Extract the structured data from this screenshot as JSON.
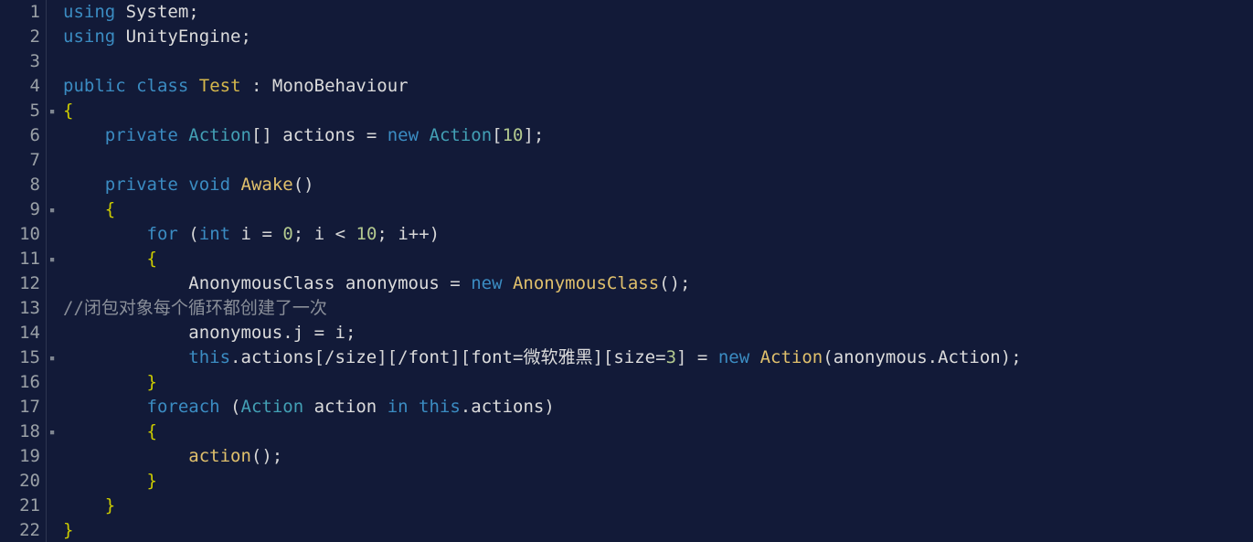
{
  "lines": {
    "1": [
      [
        "kw",
        "using"
      ],
      [
        "op",
        " "
      ],
      [
        "id",
        "System"
      ],
      [
        "pun",
        ";"
      ]
    ],
    "2": [
      [
        "kw",
        "using"
      ],
      [
        "op",
        " "
      ],
      [
        "id",
        "UnityEngine"
      ],
      [
        "pun",
        ";"
      ]
    ],
    "3": [
      [
        "op",
        ""
      ]
    ],
    "4": [
      [
        "kw",
        "public"
      ],
      [
        "op",
        " "
      ],
      [
        "kw",
        "class"
      ],
      [
        "op",
        " "
      ],
      [
        "yl",
        "Test"
      ],
      [
        "op",
        " "
      ],
      [
        "pun",
        ":"
      ],
      [
        "op",
        " "
      ],
      [
        "id",
        "MonoBehaviour"
      ]
    ],
    "5": [
      [
        "br",
        "{"
      ]
    ],
    "6": [
      [
        "op",
        "    "
      ],
      [
        "kw",
        "private"
      ],
      [
        "op",
        " "
      ],
      [
        "typ",
        "Action"
      ],
      [
        "pun",
        "[]"
      ],
      [
        "op",
        " "
      ],
      [
        "id",
        "actions"
      ],
      [
        "op",
        " "
      ],
      [
        "pun",
        "="
      ],
      [
        "op",
        " "
      ],
      [
        "kw",
        "new"
      ],
      [
        "op",
        " "
      ],
      [
        "typ",
        "Action"
      ],
      [
        "pun",
        "["
      ],
      [
        "num",
        "10"
      ],
      [
        "pun",
        "];"
      ]
    ],
    "7": [
      [
        "op",
        ""
      ]
    ],
    "8": [
      [
        "op",
        "    "
      ],
      [
        "kw",
        "private"
      ],
      [
        "op",
        " "
      ],
      [
        "kw",
        "void"
      ],
      [
        "op",
        " "
      ],
      [
        "fun",
        "Awake"
      ],
      [
        "pun",
        "()"
      ]
    ],
    "9": [
      [
        "op",
        "    "
      ],
      [
        "br",
        "{"
      ]
    ],
    "10": [
      [
        "op",
        "        "
      ],
      [
        "kw",
        "for"
      ],
      [
        "op",
        " "
      ],
      [
        "pun",
        "("
      ],
      [
        "kw",
        "int"
      ],
      [
        "op",
        " "
      ],
      [
        "id",
        "i"
      ],
      [
        "op",
        " "
      ],
      [
        "pun",
        "="
      ],
      [
        "op",
        " "
      ],
      [
        "num",
        "0"
      ],
      [
        "pun",
        ";"
      ],
      [
        "op",
        " "
      ],
      [
        "id",
        "i"
      ],
      [
        "op",
        " "
      ],
      [
        "pun",
        "<"
      ],
      [
        "op",
        " "
      ],
      [
        "num",
        "10"
      ],
      [
        "pun",
        ";"
      ],
      [
        "op",
        " "
      ],
      [
        "id",
        "i"
      ],
      [
        "pun",
        "++)"
      ]
    ],
    "11": [
      [
        "op",
        "        "
      ],
      [
        "br",
        "{"
      ]
    ],
    "12": [
      [
        "op",
        "            "
      ],
      [
        "id",
        "AnonymousClass"
      ],
      [
        "op",
        " "
      ],
      [
        "id",
        "anonymous"
      ],
      [
        "op",
        " "
      ],
      [
        "pun",
        "="
      ],
      [
        "op",
        " "
      ],
      [
        "kw",
        "new"
      ],
      [
        "op",
        " "
      ],
      [
        "fun",
        "AnonymousClass"
      ],
      [
        "pun",
        "();"
      ]
    ],
    "13": [
      [
        "cmt",
        "//闭包对象每个循环都创建了一次"
      ]
    ],
    "14": [
      [
        "op",
        "            "
      ],
      [
        "id",
        "anonymous"
      ],
      [
        "pun",
        "."
      ],
      [
        "id",
        "j"
      ],
      [
        "op",
        " "
      ],
      [
        "pun",
        "="
      ],
      [
        "op",
        " "
      ],
      [
        "id",
        "i"
      ],
      [
        "pun",
        ";"
      ]
    ],
    "15": [
      [
        "op",
        "            "
      ],
      [
        "kw",
        "this"
      ],
      [
        "pun",
        "."
      ],
      [
        "id",
        "actions"
      ],
      [
        "pun",
        "[/"
      ],
      [
        "id",
        "size"
      ],
      [
        "pun",
        "][/"
      ],
      [
        "id",
        "font"
      ],
      [
        "pun",
        "]["
      ],
      [
        "id",
        "font"
      ],
      [
        "pun",
        "="
      ],
      [
        "id",
        "微软雅黑"
      ],
      [
        "pun",
        "]["
      ],
      [
        "id",
        "size"
      ],
      [
        "pun",
        "="
      ],
      [
        "num",
        "3"
      ],
      [
        "pun",
        "]"
      ],
      [
        "op",
        " "
      ],
      [
        "pun",
        "="
      ],
      [
        "op",
        " "
      ],
      [
        "kw",
        "new"
      ],
      [
        "op",
        " "
      ],
      [
        "fun",
        "Action"
      ],
      [
        "pun",
        "("
      ],
      [
        "id",
        "anonymous"
      ],
      [
        "pun",
        "."
      ],
      [
        "id",
        "Action"
      ],
      [
        "pun",
        ");"
      ]
    ],
    "16": [
      [
        "op",
        "        "
      ],
      [
        "br",
        "}"
      ]
    ],
    "17": [
      [
        "op",
        "        "
      ],
      [
        "kw",
        "foreach"
      ],
      [
        "op",
        " "
      ],
      [
        "pun",
        "("
      ],
      [
        "typ",
        "Action"
      ],
      [
        "op",
        " "
      ],
      [
        "id",
        "action"
      ],
      [
        "op",
        " "
      ],
      [
        "kw",
        "in"
      ],
      [
        "op",
        " "
      ],
      [
        "kw",
        "this"
      ],
      [
        "pun",
        "."
      ],
      [
        "id",
        "actions"
      ],
      [
        "pun",
        ")"
      ]
    ],
    "18": [
      [
        "op",
        "        "
      ],
      [
        "br",
        "{"
      ]
    ],
    "19": [
      [
        "op",
        "            "
      ],
      [
        "fun",
        "action"
      ],
      [
        "pun",
        "();"
      ]
    ],
    "20": [
      [
        "op",
        "        "
      ],
      [
        "br",
        "}"
      ]
    ],
    "21": [
      [
        "op",
        "    "
      ],
      [
        "br",
        "}"
      ]
    ],
    "22": [
      [
        "br",
        "}"
      ]
    ]
  },
  "foldMarks": {
    "5": "▪",
    "9": "▪",
    "11": "▪",
    "15": "▪",
    "18": "▪"
  },
  "lineCount": 22
}
